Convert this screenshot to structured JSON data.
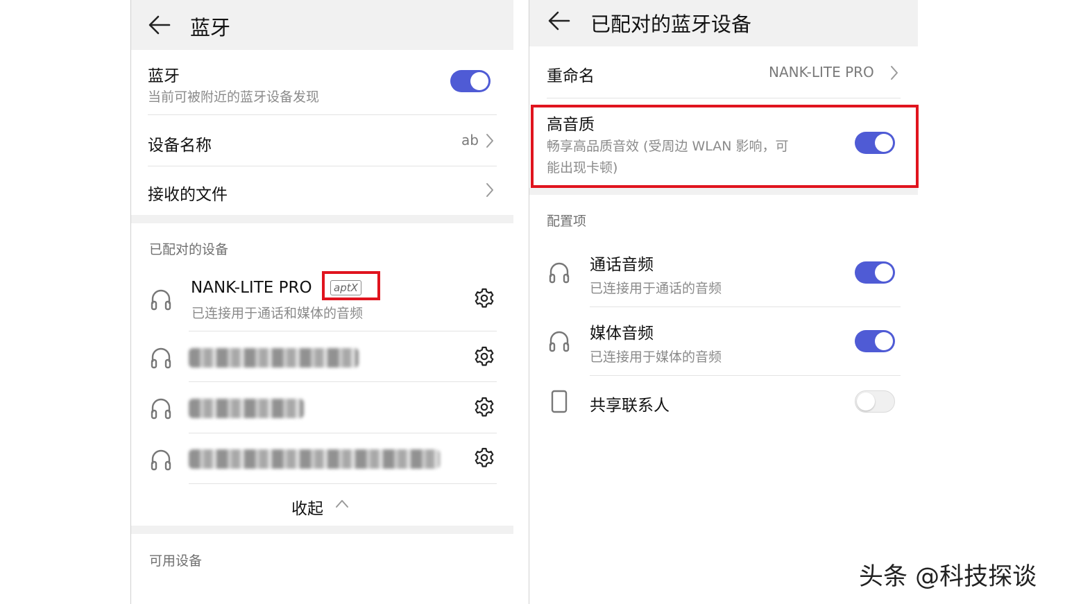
{
  "left": {
    "header": {
      "title": "蓝牙"
    },
    "bluetooth": {
      "title": "蓝牙",
      "subtitle": "当前可被附近的蓝牙设备发现",
      "toggle_on": true
    },
    "device_name": {
      "label": "设备名称",
      "value": "ab"
    },
    "received_files": {
      "label": "接收的文件"
    },
    "paired_section": {
      "title": "已配对的设备"
    },
    "paired_devices": [
      {
        "name": "NANK-LITE PRO",
        "codec": "aptX",
        "status": "已连接用于通话和媒体的音频",
        "icon": "headphones-icon"
      },
      {
        "name": "",
        "blurred": true,
        "icon": "headphones-icon"
      },
      {
        "name": "",
        "blurred": true,
        "icon": "headphones-icon"
      },
      {
        "name": "",
        "blurred": true,
        "icon": "headphones-icon"
      }
    ],
    "collapse": {
      "label": "收起"
    },
    "available_section": {
      "title": "可用设备"
    }
  },
  "right": {
    "header": {
      "title": "已配对的蓝牙设备"
    },
    "rename": {
      "label": "重命名",
      "value": "NANK-LITE PRO"
    },
    "hq_audio": {
      "title": "高音质",
      "line1": "畅享高品质音效 (受周边 WLAN 影响，可",
      "line2": "能出现卡顿)",
      "toggle_on": true
    },
    "config_section": {
      "title": "配置项"
    },
    "profiles": [
      {
        "title": "通话音频",
        "subtitle": "已连接用于通话的音频",
        "icon": "headphones-icon",
        "toggle_on": true
      },
      {
        "title": "媒体音频",
        "subtitle": "已连接用于媒体的音频",
        "icon": "headphones-icon",
        "toggle_on": true
      },
      {
        "title": "共享联系人",
        "subtitle": "",
        "icon": "phone-icon",
        "toggle_on": false
      }
    ]
  },
  "watermark": {
    "text": "头条 @科技探谈"
  },
  "colors": {
    "accent": "#4f5bd5",
    "highlight": "#e0141e",
    "header_bg": "#f1f1f1"
  }
}
